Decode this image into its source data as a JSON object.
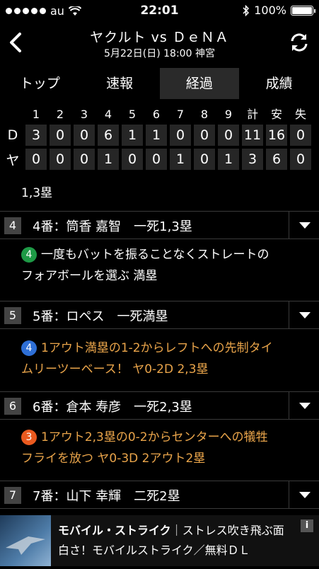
{
  "status": {
    "carrier": "au",
    "time": "22:01",
    "battery": "100%"
  },
  "header": {
    "title": "ヤクルト vs ＤｅＮＡ",
    "subtitle": "5月22日(日) 18:00 神宮"
  },
  "tabs": [
    {
      "label": "トップ",
      "active": false
    },
    {
      "label": "速報",
      "active": false
    },
    {
      "label": "経過",
      "active": true
    },
    {
      "label": "成績",
      "active": false
    }
  ],
  "scoreboard": {
    "headers": [
      "1",
      "2",
      "3",
      "4",
      "5",
      "6",
      "7",
      "8",
      "9",
      "計",
      "安",
      "失"
    ],
    "rows": [
      {
        "team": "D",
        "values": [
          "3",
          "0",
          "0",
          "6",
          "1",
          "1",
          "0",
          "0",
          "0",
          "11",
          "16",
          "0"
        ]
      },
      {
        "team": "ヤ",
        "values": [
          "0",
          "0",
          "0",
          "1",
          "0",
          "0",
          "1",
          "0",
          "1",
          "3",
          "6",
          "0"
        ]
      }
    ]
  },
  "runners": "1,3塁",
  "events": [
    {
      "num": "4",
      "label": "4番：筒香 嘉智　一死1,3塁",
      "badge": "4",
      "badge_color": "#1e9a46",
      "text_color": "#ffffff",
      "text_lines": [
        "一度もバットを振ることなくストレートの",
        "フォアボールを選ぶ 満塁"
      ]
    },
    {
      "num": "5",
      "label": "5番：ロペス　一死満塁",
      "badge": "4",
      "badge_color": "#2e6fd6",
      "text_color": "#e9a44a",
      "text_lines": [
        "1アウト満塁の1-2からレフトへの先制タイ",
        "ムリーツーベース！ ヤ0-2D 2,3塁"
      ]
    },
    {
      "num": "6",
      "label": "6番：倉本 寿彦　一死2,3塁",
      "badge": "3",
      "badge_color": "#ea5a1f",
      "text_color": "#e9a44a",
      "text_lines": [
        "1アウト2,3塁の0-2からセンターへの犠牲",
        "フライを放つ ヤ0-3D 2アウト2塁"
      ]
    },
    {
      "num": "7",
      "label": "7番：山下 幸輝　二死2塁"
    }
  ],
  "ad": {
    "title": "モバイル・ストライク",
    "title_tail": "｜ストレス吹き飛ぶ面",
    "text": "白さ！モバイルストライク／無料ＤＬ",
    "info": "i"
  }
}
